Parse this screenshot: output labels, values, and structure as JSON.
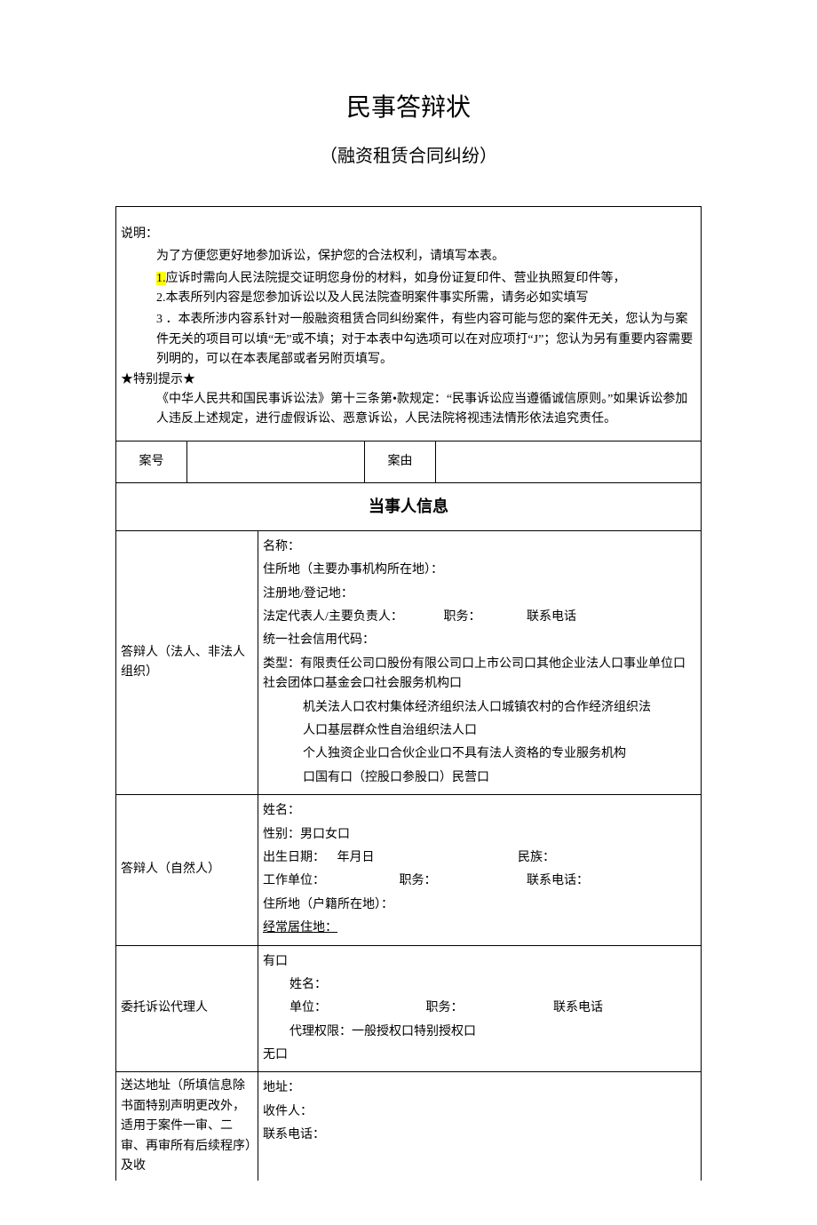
{
  "title": "民事答辩状",
  "subtitle": "（融资租赁合同纠纷）",
  "instructions": {
    "heading": "说明：",
    "intro": "为了方便您更好地参加诉讼，保护您的合法权利，请填写本表。",
    "p1_prefix": "1.",
    "p1": "应诉时需向人民法院提交证明您身份的材料，如身份证复印件、营业执照复印件等，",
    "p2": "2.本表所列内容是您参加诉讼以及人民法院查明案件事实所需，请务必如实填写",
    "p3": "3 ．本表所涉内容系针对一般融资租赁合同纠纷案件，有些内容可能与您的案件无关，您认为与案件无关的项目可以填“无”或不填；对于本表中勾选项可以在对应项打“J”；您认为另有重要内容需要列明的，可以在本表尾部或者另附页填写。",
    "tip_head": "★特别提示★",
    "tip": "《中华人民共和国民事诉讼法》第十三条第•款规定：“民事诉讼应当遵循诚信原则。”如果诉讼参加人违反上述规定，进行虚假诉讼、恶意诉讼，人民法院将视违法情形依法追究责任。"
  },
  "case": {
    "no_label": "案号",
    "no_value": "",
    "cause_label": "案由",
    "cause_value": ""
  },
  "section_heading": "当事人信息",
  "respondent_org": {
    "label": "答辩人（法人、非法人组织）",
    "name": "名称：",
    "domicile": "住所地（主要办事机构所在地）：",
    "registered": "注册地/登记地：",
    "legal_rep": "法定代表人/主要负责人：",
    "position": "职务：",
    "phone": "联系电话",
    "uscc": "统一社会信用代码：",
    "type_label": "类型：",
    "type_line1": "有限责任公司口股份有限公司口上市公司口其他企业法人口事业单位口社会团体口基金会口社会服务机构口",
    "type_line2": "机关法人口农村集体经济组织法人口城镇农村的合作经济组织法",
    "type_line3": "人口基层群众性自治组织法人口",
    "type_line4": "个人独资企业口合伙企业口不具有法人资格的专业服务机构",
    "type_line5": "口国有口（控股口参股口）民营口"
  },
  "respondent_person": {
    "label": "答辩人（自然人）",
    "name": "姓名：",
    "gender": "性别：男口女口",
    "dob_label": "出生日期：",
    "dob_value": "年月日",
    "ethnicity": "民族：",
    "employer": "工作单位：",
    "position": "职务：",
    "phone": "联系电话：",
    "domicile": "住所地（户籍所在地）：",
    "residence": "经常居住地："
  },
  "agent": {
    "label": "委托诉讼代理人",
    "has": "有口",
    "name": "姓名：",
    "unit": "单位：",
    "position": "职务：",
    "phone": "联系电话",
    "authority": "代理权限：一般授权口特别授权口",
    "none": "无口"
  },
  "delivery": {
    "label": "送达地址（所填信息除书面特别声明更改外，适用于案件一审、二审、再审所有后续程序）及收",
    "address": "地址：",
    "recipient": "收件人：",
    "phone": "联系电话："
  }
}
